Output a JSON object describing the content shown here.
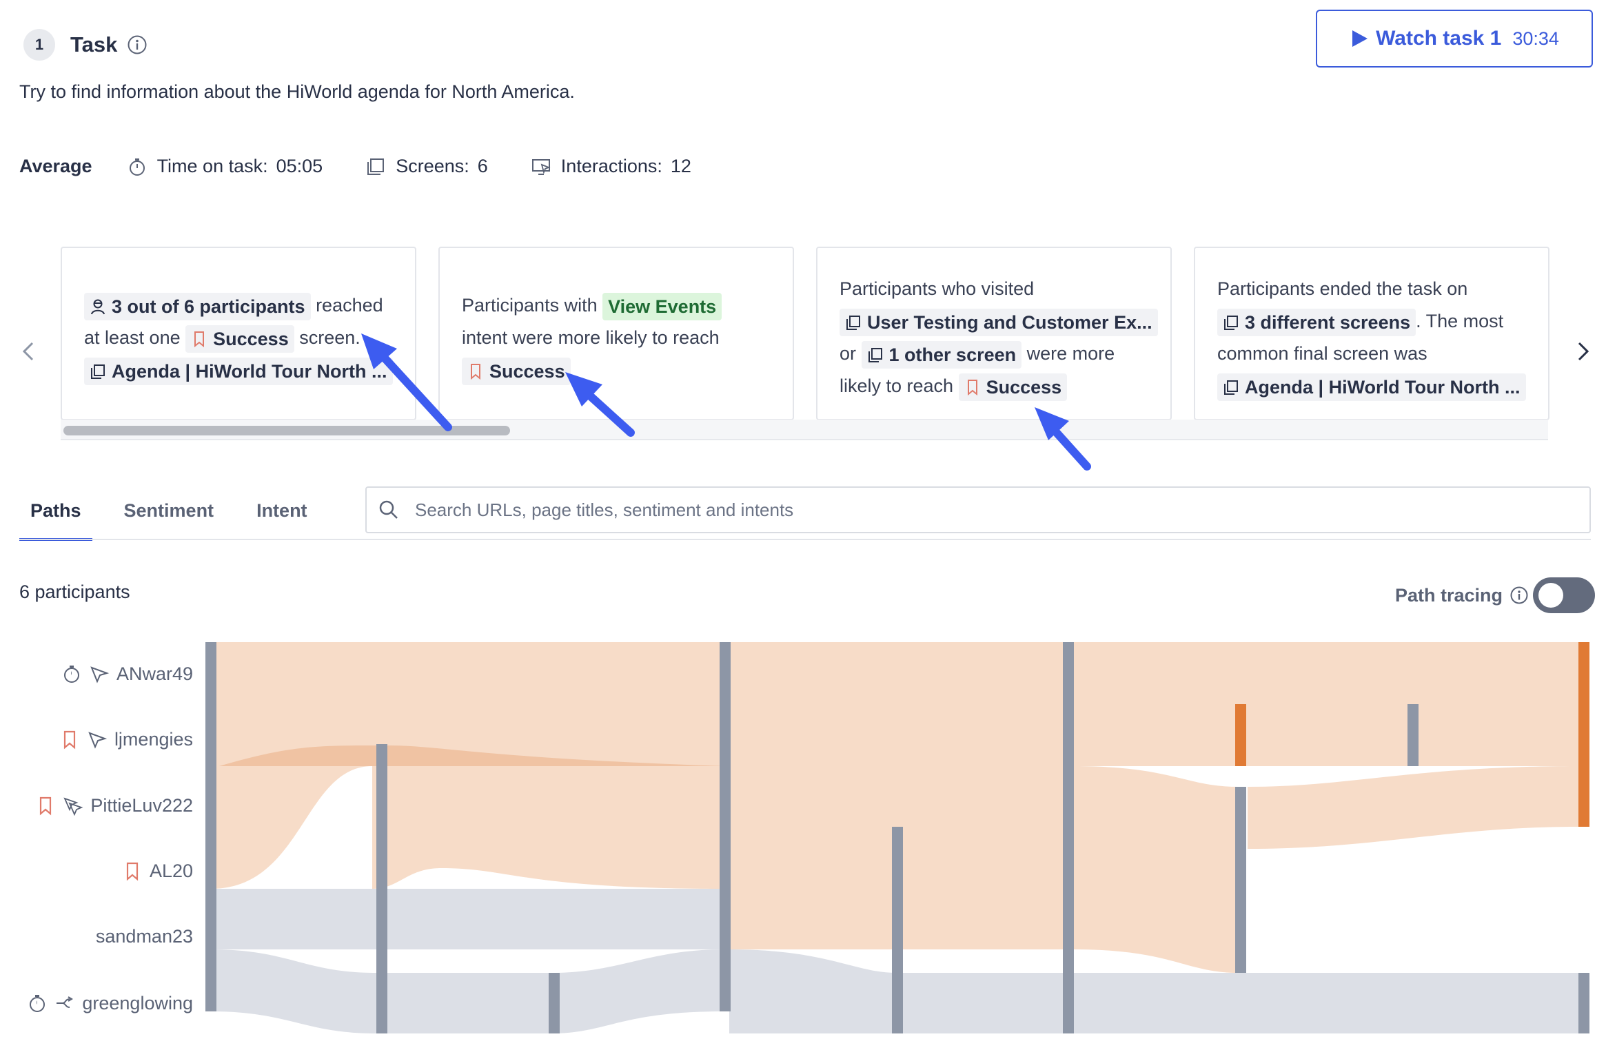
{
  "task": {
    "number": "1",
    "title": "Task",
    "description": "Try to find information about the HiWorld agenda for North America."
  },
  "watch": {
    "label": "Watch task 1",
    "time": "30:34"
  },
  "average": {
    "label": "Average",
    "time_label": "Time on task:",
    "time_value": "05:05",
    "screens_label": "Screens:",
    "screens_value": "6",
    "interactions_label": "Interactions:",
    "interactions_value": "12"
  },
  "cards": {
    "c1": {
      "chip_participants": "3 out of 6 participants",
      "t1": "reached",
      "t2": "at least one",
      "chip_success": "Success",
      "t3": "screen.",
      "chip_screen": "Agenda | HiWorld Tour North ..."
    },
    "c2": {
      "t1": "Participants with",
      "chip_intent": "View Events",
      "t2": "intent were more likely to reach",
      "chip_success": "Success"
    },
    "c3": {
      "t1": "Participants who visited",
      "chip_screen": "User Testing and Customer Ex...",
      "t2": "or",
      "chip_other": "1 other screen",
      "t3": "were more",
      "t4": "likely to reach",
      "chip_success": "Success"
    },
    "c4": {
      "t1": "Participants ended the task on",
      "chip_screens": "3 different screens",
      "t2": ". The most",
      "t3": "common final screen was",
      "chip_screen": "Agenda | HiWorld Tour North ..."
    }
  },
  "tabs": {
    "paths": "Paths",
    "sentiment": "Sentiment",
    "intent": "Intent"
  },
  "search": {
    "placeholder": "Search URLs, page titles, sentiment and intents"
  },
  "participants_count": "6 participants",
  "path_tracing": {
    "label": "Path tracing",
    "enabled": false
  },
  "participants": [
    {
      "name": "ANwar49",
      "icons": [
        "stopwatch-icon",
        "cursor-icon"
      ]
    },
    {
      "name": "ljmengies",
      "icons": [
        "bookmark-icon",
        "cursor-icon"
      ]
    },
    {
      "name": "PittieLuv222",
      "icons": [
        "bookmark-icon",
        "multi-cursor-icon"
      ]
    },
    {
      "name": "AL20",
      "icons": [
        "bookmark-icon"
      ]
    },
    {
      "name": "sandman23",
      "icons": []
    },
    {
      "name": "greenglowing",
      "icons": [
        "stopwatch-icon",
        "branch-icon"
      ]
    }
  ],
  "colors": {
    "accent": "#3b5bdb",
    "success_flow": "#f7dcc8",
    "success_flow_dark": "#f0c3a3",
    "fail_flow": "#dcdfe6",
    "node": "#8d96a6",
    "success_node": "#e07a34"
  }
}
